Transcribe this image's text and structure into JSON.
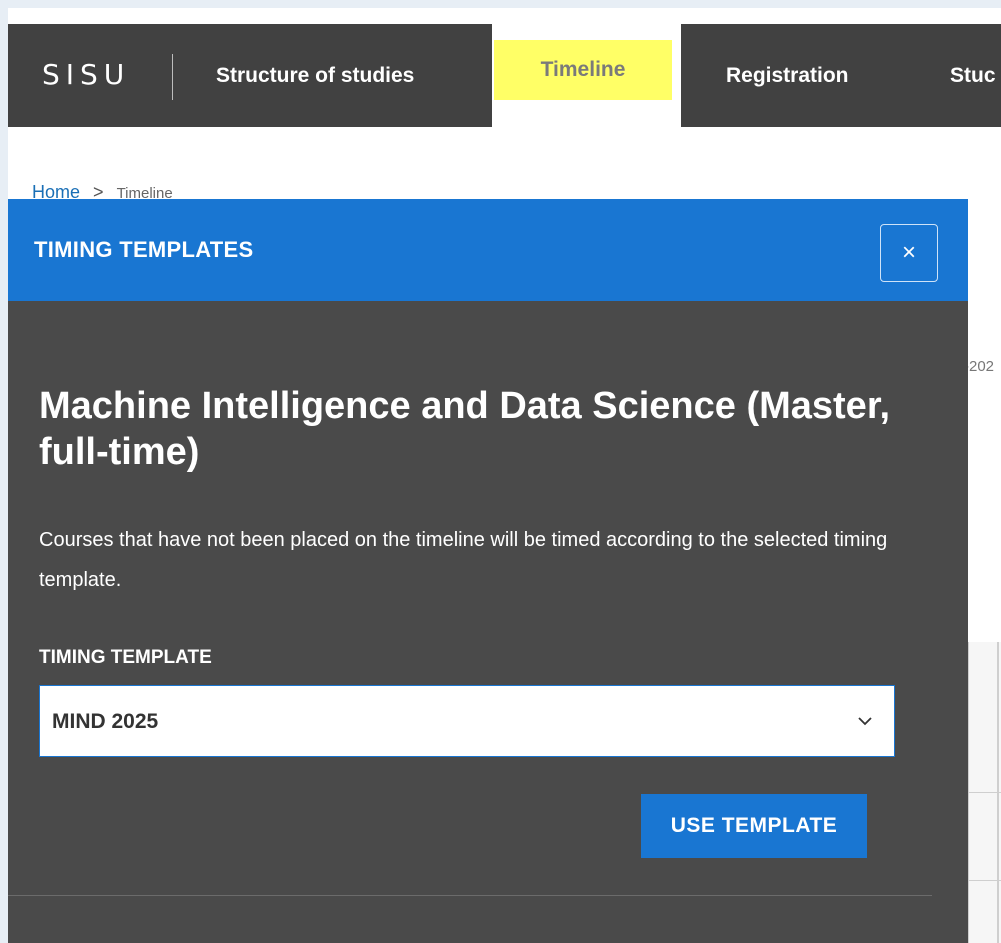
{
  "nav": {
    "logo": "SISU",
    "items": [
      {
        "label": "Structure of studies"
      },
      {
        "label": "Timeline"
      },
      {
        "label": "Registration"
      },
      {
        "label": "Stuc"
      }
    ]
  },
  "breadcrumb": {
    "home": "Home",
    "separator": ">",
    "current": "Timeline"
  },
  "background": {
    "year_fragment": "-202"
  },
  "modal": {
    "header_title": "TIMING TEMPLATES",
    "close_label": "×",
    "program_title": "Machine Intelligence and Data Science (Master, full-time)",
    "description": "Courses that have not been placed on the timeline will be timed according to the selected timing template.",
    "field_label": "TIMING TEMPLATE",
    "selected_template": "MIND 2025",
    "use_button": "USE TEMPLATE"
  },
  "colors": {
    "nav_bg": "#414141",
    "accent": "#1976d2",
    "highlight": "#ffff66",
    "modal_bg": "#4a4a4a"
  },
  "icons": {
    "close": "close-icon",
    "dropdown": "chevron-down-icon",
    "breadcrumb_sep": "chevron-right-icon"
  }
}
